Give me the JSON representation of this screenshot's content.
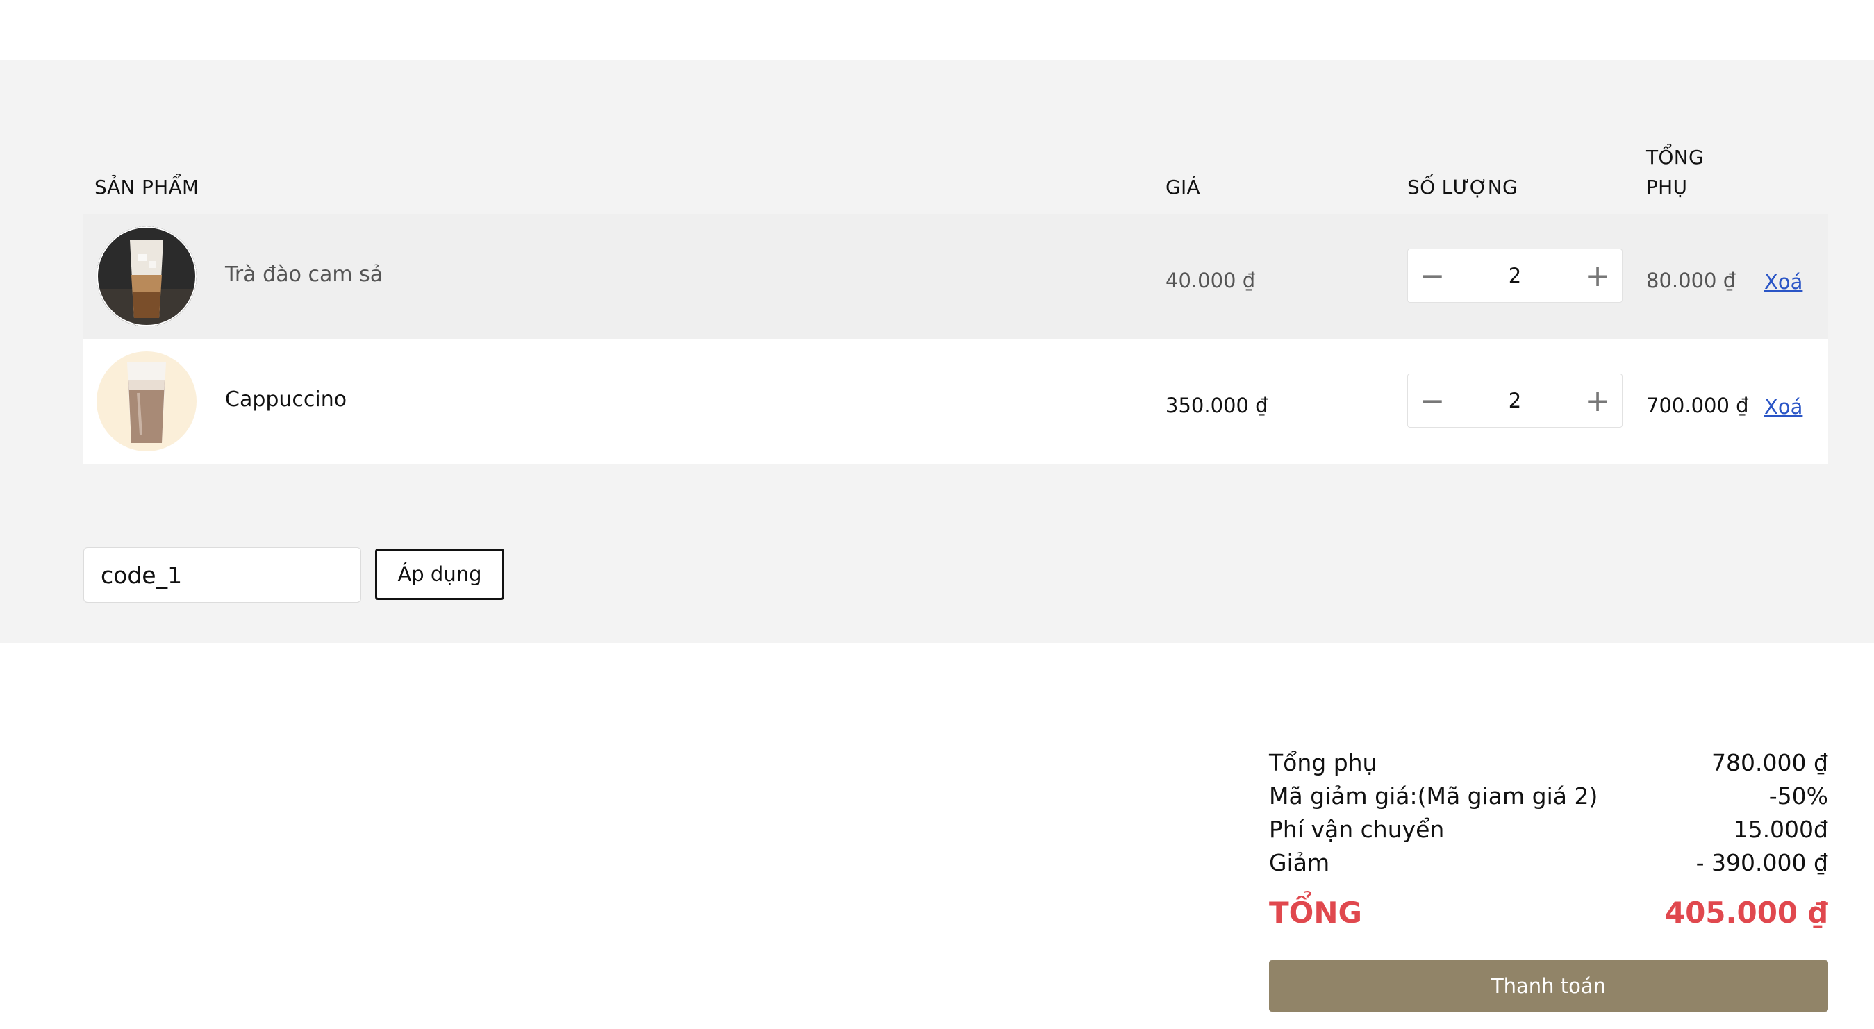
{
  "table": {
    "headers": {
      "product": "SẢN PHẨM",
      "price": "GIÁ",
      "quantity": "SỐ LƯỢNG",
      "subtotal_line1": "TỔNG",
      "subtotal_line2": "PHỤ"
    },
    "items": [
      {
        "name": "Trà đào cam sả",
        "price": "40.000 ₫",
        "quantity": "2",
        "subtotal": "80.000 ₫",
        "remove_label": "Xoá"
      },
      {
        "name": "Cappuccino",
        "price": "350.000 ₫",
        "quantity": "2",
        "subtotal": "700.000 ₫",
        "remove_label": "Xoá"
      }
    ]
  },
  "coupon": {
    "value": "code_1",
    "apply_label": "Áp dụng"
  },
  "summary": {
    "subtotal_label": "Tổng phụ",
    "subtotal_value": "780.000 ₫",
    "discount_code_label": "Mã giảm giá:(Mã giam giá 2)",
    "discount_code_value": "-50%",
    "shipping_label": "Phí vận chuyển",
    "shipping_value": "15.000đ",
    "reduction_label": "Giảm",
    "reduction_value": "- 390.000 ₫",
    "total_label": "TỔNG",
    "total_value": "405.000 ₫",
    "checkout_label": "Thanh toán"
  },
  "colors": {
    "section_bg": "#f3f3f3",
    "total_red": "#e0484e",
    "checkout_bg": "#918468",
    "link_blue": "#2a55c6"
  }
}
